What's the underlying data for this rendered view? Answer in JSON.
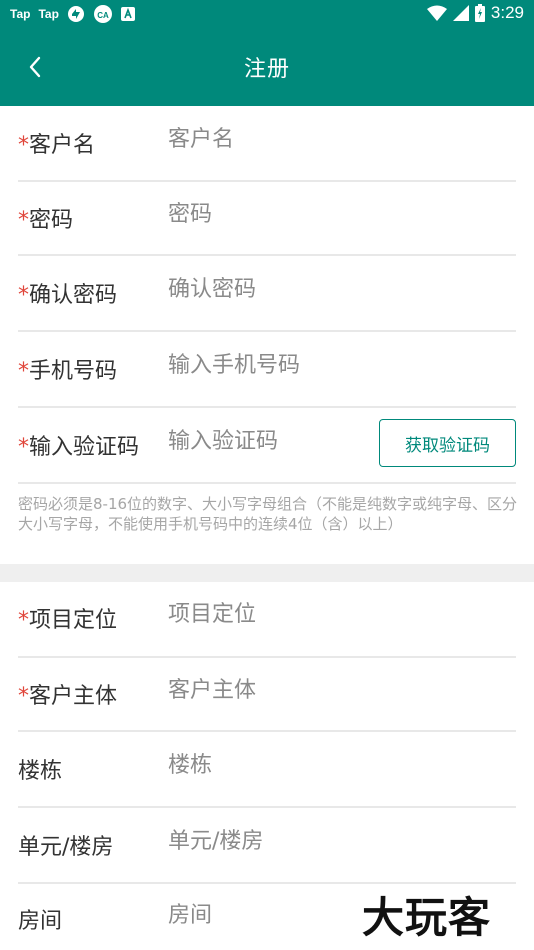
{
  "status_bar": {
    "left_apps": [
      "Tap",
      "Tap"
    ],
    "time": "3:29",
    "icons": [
      "taptap-icon",
      "taptap-icon",
      "sync-icon",
      "cloud-icon",
      "app-icon",
      "wifi-icon",
      "signal-icon",
      "battery-icon"
    ]
  },
  "app_bar": {
    "title": "注册",
    "back_icon": "chevron-left-icon"
  },
  "form_top": [
    {
      "label": "客户名",
      "required": true,
      "placeholder": "客户名"
    },
    {
      "label": "密码",
      "required": true,
      "placeholder": "密码"
    },
    {
      "label": "确认密码",
      "required": true,
      "placeholder": "确认密码"
    },
    {
      "label": "手机号码",
      "required": true,
      "placeholder": "输入手机号码"
    },
    {
      "label": "输入验证码",
      "required": true,
      "placeholder": "输入验证码",
      "button": "获取验证码"
    }
  ],
  "required_mark": "*",
  "hint": "密码必须是8-16位的数字、大小写字母组合（不能是纯数字或纯字母、区分大小写字母，不能使用手机号码中的连续4位（含）以上）",
  "form_bottom": [
    {
      "label": "项目定位",
      "required": true,
      "placeholder": "项目定位"
    },
    {
      "label": "客户主体",
      "required": true,
      "placeholder": "客户主体"
    },
    {
      "label": "楼栋",
      "required": false,
      "placeholder": "楼栋"
    },
    {
      "label": "单元/楼房",
      "required": false,
      "placeholder": "单元/楼房"
    },
    {
      "label": "房间",
      "required": false,
      "placeholder": "房间"
    }
  ],
  "watermark": "大玩客",
  "colors": {
    "primary": "#00897b",
    "required": "#e0463b",
    "hint": "#a6a6a6"
  }
}
